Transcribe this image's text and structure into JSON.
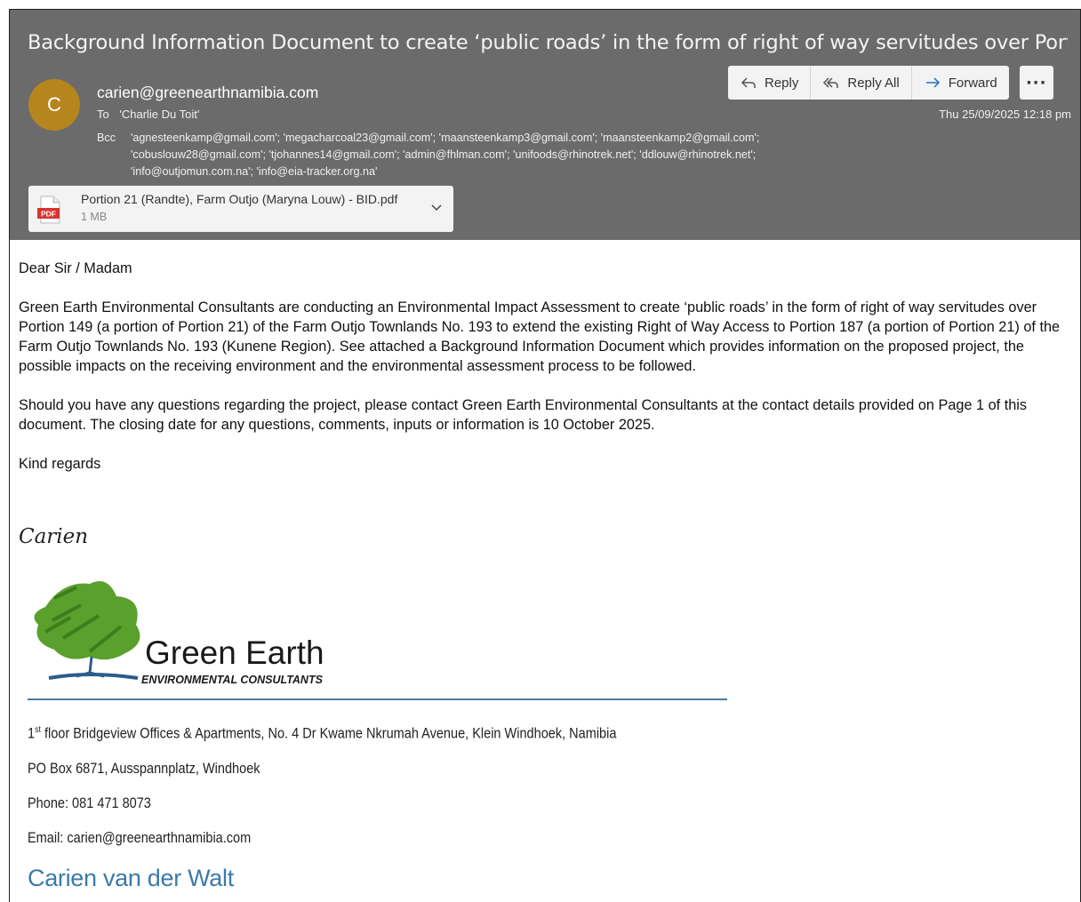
{
  "email": {
    "subject": "Background Information Document to create ‘public roads’ in the form of right of way servitudes over Porti...",
    "avatar_initial": "C",
    "from": "carien@greenearthnamibia.com",
    "to_label": "To",
    "to": "'Charlie Du Toit'",
    "bcc_label": "Bcc",
    "bcc_lines": [
      "'agnesteenkamp@gmail.com'; 'megacharcoal23@gmail.com'; 'maansteenkamp3@gmail.com'; 'maansteenkamp2@gmail.com';",
      "'cobuslouw28@gmail.com'; 'tjohannes14@gmail.com'; 'admin@fhlman.com'; 'unifoods@rhinotrek.net'; 'ddlouw@rhinotrek.net';",
      "'info@outjomun.com.na'; 'info@eia-tracker.org.na'"
    ],
    "date": "Thu 25/09/2025 12:18 pm",
    "actions": {
      "reply": "Reply",
      "reply_all": "Reply All",
      "forward": "Forward",
      "more": "···"
    },
    "attachment": {
      "icon_label": "PDF",
      "name": "Portion 21 (Randte), Farm Outjo (Maryna Louw) - BID.pdf",
      "size": "1 MB"
    }
  },
  "body": {
    "greeting": "Dear Sir / Madam",
    "paragraph1": "Green Earth Environmental Consultants are conducting an Environmental Impact Assessment to create ‘public roads’ in the form of right of way servitudes over Portion 149 (a portion of Portion 21) of the Farm Outjo Townlands No. 193 to extend the existing Right of Way Access to Portion 187 (a portion of Portion 21) of the Farm Outjo Townlands No. 193 (Kunene Region).  See attached a Background Information Document which provides information on the proposed project, the possible impacts on the receiving environment and the environmental assessment process to be followed.",
    "paragraph2": "Should you have any questions regarding the project, please contact Green Earth Environmental Consultants at the contact details provided on Page 1 of this document.  The closing date for any questions, comments, inputs or information is 10 October 2025.",
    "closing": "Kind regards"
  },
  "signature": {
    "script_name": "Carien",
    "logo_title": "Green Earth",
    "logo_subtitle": "ENVIRONMENTAL CONSULTANTS",
    "address_prefix": "1",
    "address_sup": "st",
    "address_rest": " floor Bridgeview Offices & Apartments, No. 4 Dr Kwame Nkrumah Avenue, Klein Windhoek, Namibia",
    "po_box": "PO Box 6871, Ausspannplatz, Windhoek",
    "phone": "Phone: 081 471 8073",
    "email": "Email: carien@greenearthnamibia.com",
    "full_name": "Carien van der Walt"
  },
  "colors": {
    "header_bg": "#6b6b6b",
    "avatar_bg": "#b5851e",
    "logo_green": "#5aa02c",
    "rule_blue": "#4a7fa1",
    "name_blue": "#3b7aa8",
    "pdf_red": "#d9322e"
  }
}
